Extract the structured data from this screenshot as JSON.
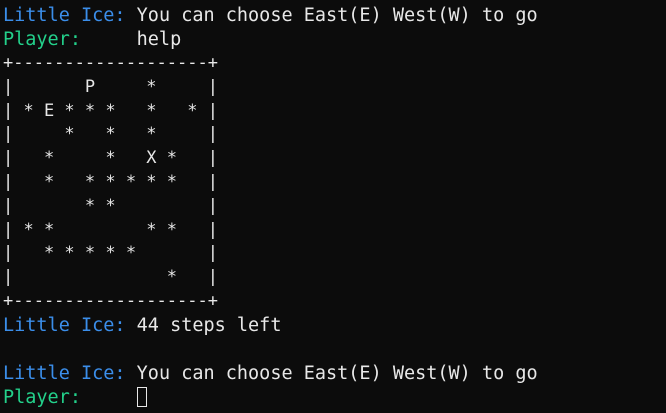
{
  "terminal": {
    "lines_top": [
      {
        "speaker": "Little Ice:",
        "speaker_role": "ice",
        "text": " You can choose East(E) West(W) to go"
      },
      {
        "speaker": "Player:",
        "speaker_role": "player",
        "text": "     help"
      }
    ],
    "board": {
      "rows": [
        "+-------------------+",
        "|       P     *     |",
        "| * E * * *   *   * |",
        "|     *   *   *     |",
        "|   *     *   X *   |",
        "|   *   * * * * *   |",
        "|       * *         |",
        "| * *         * *   |",
        "|   * * * * *       |",
        "|               *   |",
        "+-------------------+"
      ]
    },
    "status": {
      "speaker": "Little Ice:",
      "text": " 44 steps left"
    },
    "lines_bottom": [
      {
        "speaker": "Little Ice:",
        "speaker_role": "ice",
        "text": " You can choose East(E) West(W) to go"
      },
      {
        "speaker": "Player:",
        "speaker_role": "player",
        "text": "     "
      }
    ],
    "colors": {
      "background": "#0c0c0c",
      "text": "#e8e8e8",
      "little_ice": "#3b8eea",
      "player": "#23d18b"
    }
  }
}
